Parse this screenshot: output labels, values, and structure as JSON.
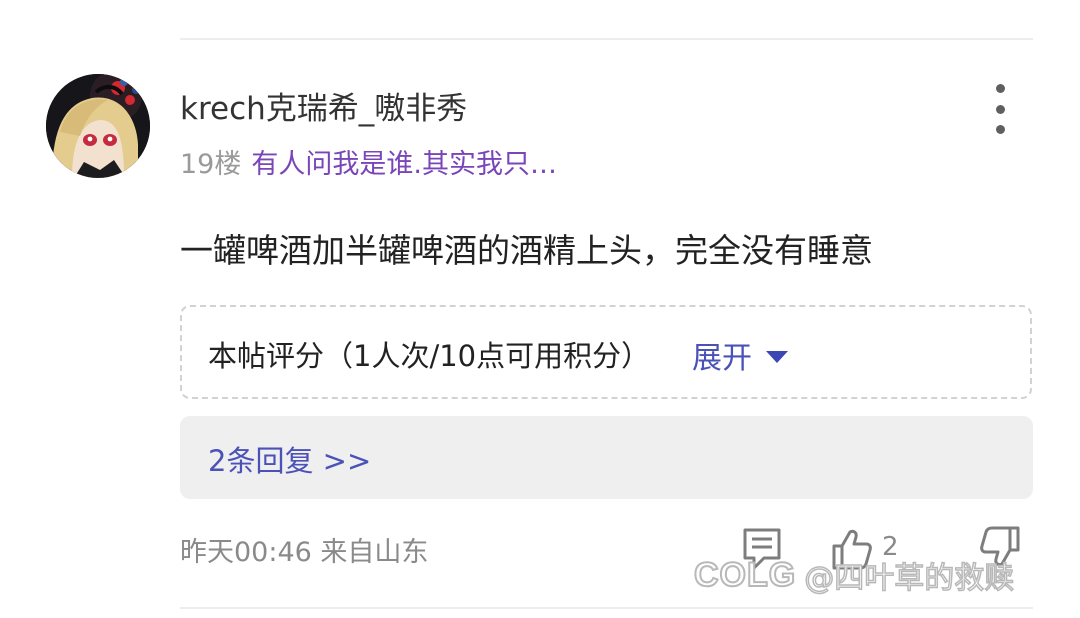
{
  "post": {
    "username": "krech克瑞希_嗷非秀",
    "floor": "19楼",
    "signature": "有人问我是谁.其实我只…",
    "content": "一罐啤酒加半罐啤酒的酒精上头，完全没有睡意",
    "rating": {
      "label": "本帖评分（1人次/10点可用积分）",
      "expand_label": "展开"
    },
    "replies_link": "2条回复 >>",
    "time_location": "昨天00:46 来自山东",
    "like_count": "2"
  },
  "watermark": {
    "logo": "COLG",
    "handle": "@四叶草的救赎"
  },
  "icons": {
    "more": "more-vertical-icon",
    "expand": "caret-down-icon",
    "reply": "comment-icon",
    "like": "thumbs-up-icon",
    "dislike": "thumbs-down-icon"
  },
  "colors": {
    "signature": "#7a45b9",
    "link": "#4a52b8",
    "reply_bg": "#efefef",
    "muted_text": "#8a8a8a"
  }
}
